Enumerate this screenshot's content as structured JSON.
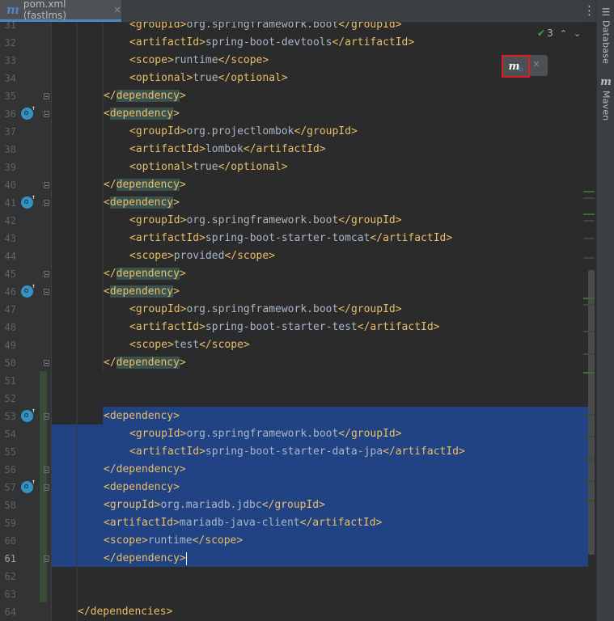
{
  "tab": {
    "icon": "maven-m-icon",
    "title": "pom.xml (fastlms)",
    "close_label": "×",
    "menu_label": "⋮"
  },
  "inspection": {
    "count": "3",
    "up_label": "⌃",
    "down_label": "⌄"
  },
  "maven_popup": {
    "icon_letter": "m",
    "reload_glyph": "↻",
    "close_label": "×"
  },
  "right_strip": {
    "database_label": "Database",
    "maven_label": "Maven"
  },
  "lines": [
    {
      "n": "31",
      "text": "    <groupId>org.springframework.boot</groupId>"
    },
    {
      "n": "32",
      "text": "    <artifactId>spring-boot-devtools</artifactId>"
    },
    {
      "n": "33",
      "text": "    <scope>runtime</scope>"
    },
    {
      "n": "34",
      "text": "    <optional>true</optional>"
    },
    {
      "n": "35",
      "text": "</dependency>"
    },
    {
      "n": "36",
      "text": "<dependency>"
    },
    {
      "n": "37",
      "text": "    <groupId>org.projectlombok</groupId>"
    },
    {
      "n": "38",
      "text": "    <artifactId>lombok</artifactId>"
    },
    {
      "n": "39",
      "text": "    <optional>true</optional>"
    },
    {
      "n": "40",
      "text": "</dependency>"
    },
    {
      "n": "41",
      "text": "<dependency>"
    },
    {
      "n": "42",
      "text": "    <groupId>org.springframework.boot</groupId>"
    },
    {
      "n": "43",
      "text": "    <artifactId>spring-boot-starter-tomcat</artifactId>"
    },
    {
      "n": "44",
      "text": "    <scope>provided</scope>"
    },
    {
      "n": "45",
      "text": "</dependency>"
    },
    {
      "n": "46",
      "text": "<dependency>"
    },
    {
      "n": "47",
      "text": "    <groupId>org.springframework.boot</groupId>"
    },
    {
      "n": "48",
      "text": "    <artifactId>spring-boot-starter-test</artifactId>"
    },
    {
      "n": "49",
      "text": "    <scope>test</scope>"
    },
    {
      "n": "50",
      "text": "</dependency>"
    },
    {
      "n": "51",
      "text": ""
    },
    {
      "n": "52",
      "text": ""
    },
    {
      "n": "53",
      "text": "<dependency>"
    },
    {
      "n": "54",
      "text": "    <groupId>org.springframework.boot</groupId>"
    },
    {
      "n": "55",
      "text": "    <artifactId>spring-boot-starter-data-jpa</artifactId>"
    },
    {
      "n": "56",
      "text": "</dependency>"
    },
    {
      "n": "57",
      "text": "<dependency>"
    },
    {
      "n": "58",
      "text": "<groupId>org.mariadb.jdbc</groupId>"
    },
    {
      "n": "59",
      "text": "<artifactId>mariadb-java-client</artifactId>"
    },
    {
      "n": "60",
      "text": "<scope>runtime</scope>"
    },
    {
      "n": "61",
      "text": "</dependency>"
    },
    {
      "n": "62",
      "text": ""
    },
    {
      "n": "63",
      "text": ""
    },
    {
      "n": "64",
      "text": "</dependencies>"
    }
  ]
}
